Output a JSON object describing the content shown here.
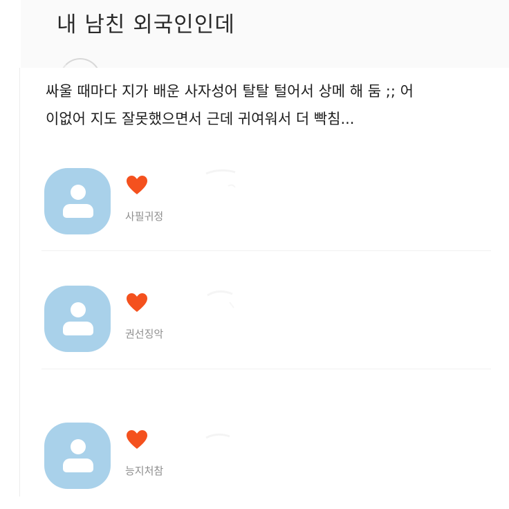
{
  "post": {
    "title": "내 남친 외국인인데",
    "body_line_1": "싸울 때마다 지가 배운 사자성어 탈탈 털어서 상메 해 둠 ;; 어",
    "body_line_2": "이없어 지도 잘못했으면서 근데 귀여워서 더 빡침..."
  },
  "comments": [
    {
      "icon": "heart-icon",
      "nickname": "사필귀정"
    },
    {
      "icon": "heart-icon",
      "nickname": "권선징악"
    },
    {
      "icon": "heart-icon",
      "nickname": "능지처참"
    }
  ],
  "colors": {
    "avatar": "#a9d1ea",
    "heart": "#f4511e",
    "nickname": "#8e8e8e",
    "text": "#1c1c1c"
  }
}
